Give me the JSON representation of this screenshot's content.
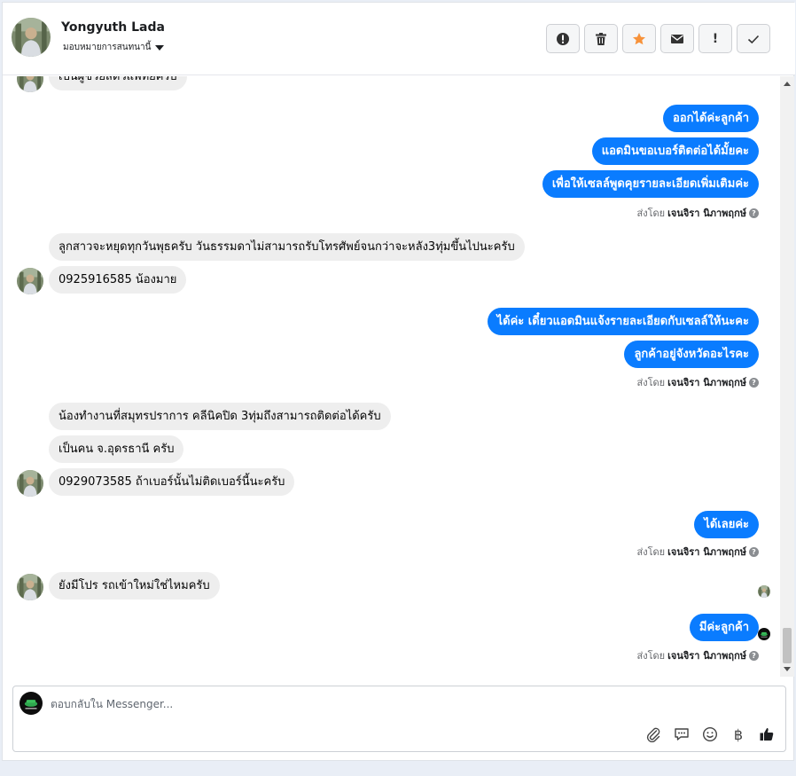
{
  "header": {
    "contact_name": "Yongyuth Lada",
    "assignee_label": "มอบหมายการสนทนานี้",
    "actions": [
      {
        "name": "spam-button",
        "icon": "alert-circle-icon"
      },
      {
        "name": "delete-button",
        "icon": "trash-icon"
      },
      {
        "name": "star-button",
        "icon": "star-icon",
        "color": "#f7923a"
      },
      {
        "name": "mark-unread-button",
        "icon": "envelope-icon"
      },
      {
        "name": "follow-up-button",
        "icon": "exclamation-icon",
        "label": "!"
      },
      {
        "name": "mark-done-button",
        "icon": "check-icon"
      }
    ]
  },
  "messages": {
    "m1": "เป็นผู้ช่วยสัตวแพทย์ครับ",
    "m2": "ออกได้ค่ะลูกค้า",
    "m3": "แอดมินขอเบอร์ติดต่อได้มั้ยคะ",
    "m4": "เพื่อให้เซลล์พูดคุยรายละเอียดเพิ่มเติมค่ะ",
    "m5": "ลูกสาวจะหยุดทุกวันพุธครับ วันธรรมดาไม่สามารถรับโทรศัพย์จนกว่าจะหลัง3ทุ่มขึ้นไปนะครับ",
    "m6": "0925916585 น้องมาย",
    "m7": "ได้ค่ะ เดี๋ยวแอดมินแจ้งรายละเอียดกับเซลล์ให้นะคะ",
    "m8": "ลูกค้าอยู่จังหวัดอะไรคะ",
    "m9": "น้องทำงานที่สมุทรปราการ คลีนิคปิด 3ทุ่มถึงสามารถติดต่อได้ครับ",
    "m10": "เป็นคน จ.อุดรธานี  ครับ",
    "m11": "0929073585  ถ้าเบอร์นั้นไม่ติดเบอร์นี้นะครับ",
    "m12": "ได้เลยค่ะ",
    "m13": "ยังมีโปร รถเข้าใหม่ใช่ไหมครับ",
    "m14": "มีค่ะลูกค้า"
  },
  "sent_by": {
    "prefix": "ส่งโดย",
    "agent": "เจนจิรา นิภาพฤกษ์",
    "help": "?"
  },
  "composer": {
    "placeholder": "ตอบกลับใน Messenger...",
    "tools": [
      "paperclip-icon",
      "saved-reply-icon",
      "emoji-icon",
      "baht-icon",
      "thumbs-up-icon"
    ],
    "baht_symbol": "฿"
  },
  "colors": {
    "outgoing_bubble": "#0a7cff",
    "incoming_bubble": "#eeeeee",
    "star": "#f7923a"
  }
}
